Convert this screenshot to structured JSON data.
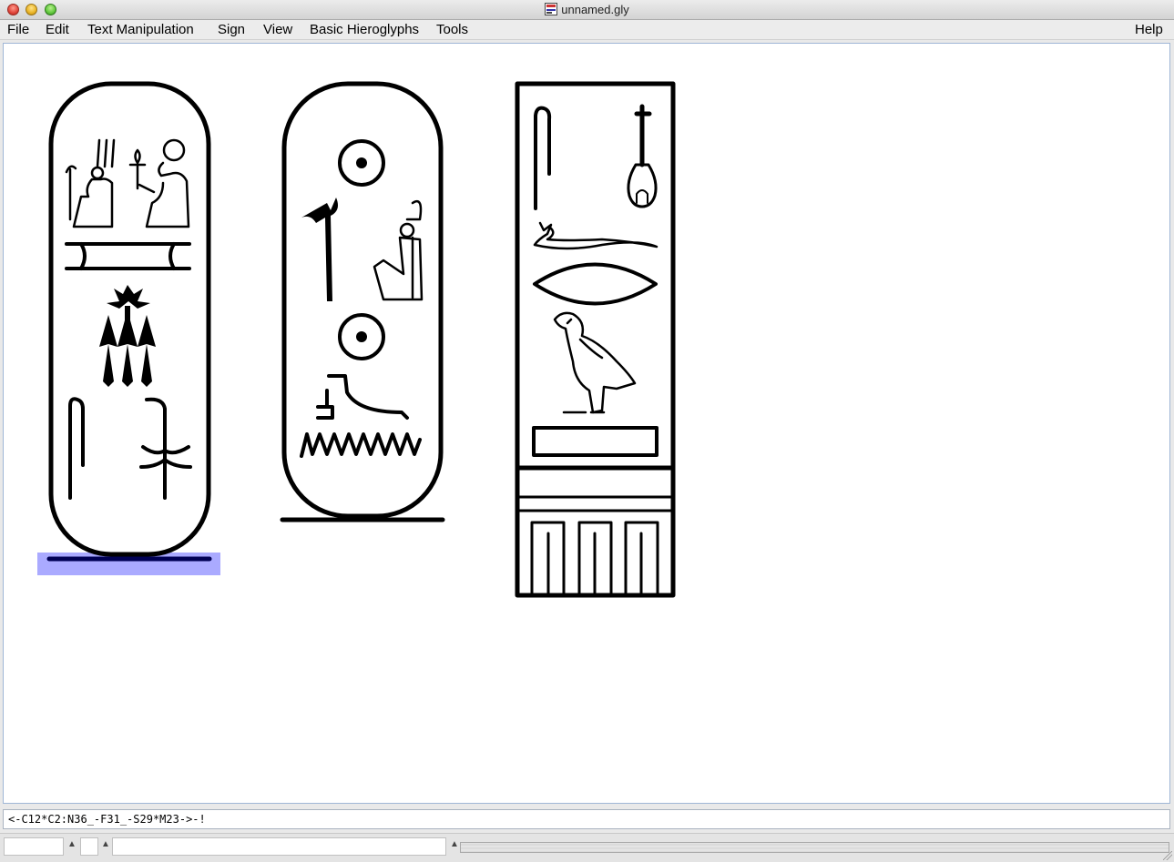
{
  "window": {
    "title": "unnamed.gly"
  },
  "menu": [
    "File",
    "Edit",
    "Text Manipulation",
    "Sign",
    "View",
    "Basic Hieroglyphs",
    "Tools",
    "Help"
  ],
  "code_line": "<-C12*C2:N36_-F31_-S29*M23->-!",
  "status": {
    "field1": "",
    "field2": "",
    "field3": ""
  },
  "colors": {
    "selection": "#aaaaff",
    "canvas_border": "#9fb6d6"
  },
  "glyph_groups": [
    {
      "name": "cartouche-1",
      "signs": [
        "C12",
        "C2",
        "N36",
        "M16",
        "Z1",
        "M23"
      ],
      "selected": true
    },
    {
      "name": "cartouche-2",
      "signs": [
        "N5",
        "F20",
        "C10",
        "N5",
        "D36",
        "N35"
      ]
    },
    {
      "name": "serekh",
      "signs": [
        "Z1",
        "S29",
        "I10",
        "D21",
        "G1",
        "N35"
      ]
    }
  ]
}
